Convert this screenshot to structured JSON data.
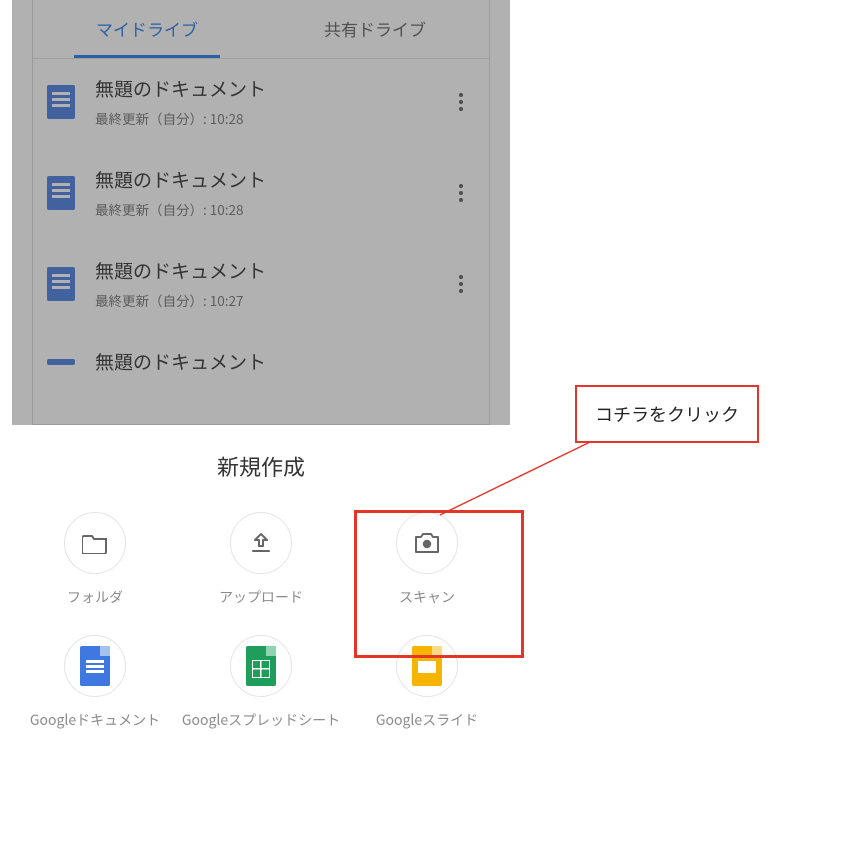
{
  "tabs": {
    "my_drive": "マイドライブ",
    "shared_drive": "共有ドライブ"
  },
  "files": [
    {
      "title": "無題のドキュメント",
      "meta": "最終更新（自分）: 10:28"
    },
    {
      "title": "無題のドキュメント",
      "meta": "最終更新（自分）: 10:28"
    },
    {
      "title": "無題のドキュメント",
      "meta": "最終更新（自分）: 10:27"
    },
    {
      "title": "無題のドキュメント",
      "meta": ""
    }
  ],
  "sheet": {
    "title": "新規作成",
    "items": {
      "folder": "フォルダ",
      "upload": "アップロード",
      "scan": "スキャン",
      "gdoc": "Googleドキュメント",
      "gsheet": "Googleスプレッドシート",
      "gslide": "Googleスライド"
    }
  },
  "callout": "コチラをクリック"
}
